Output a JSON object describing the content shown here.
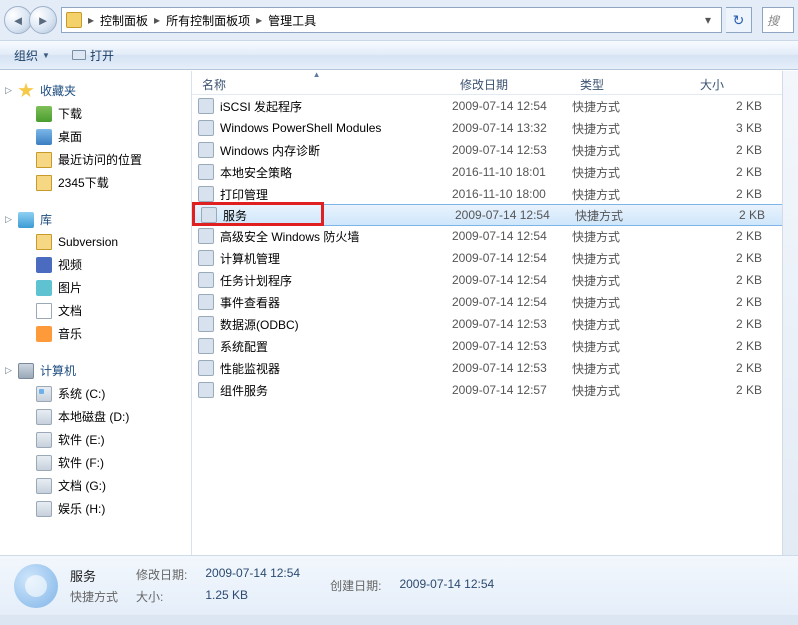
{
  "breadcrumbs": {
    "items": [
      "控制面板",
      "所有控制面板项",
      "管理工具"
    ]
  },
  "toolbar": {
    "organize": "组织",
    "open": "打开"
  },
  "search": {
    "placeholder": "搜"
  },
  "sidebar": {
    "favorites": {
      "label": "收藏夹",
      "items": [
        {
          "label": "下载",
          "icon": "dl"
        },
        {
          "label": "桌面",
          "icon": "desk"
        },
        {
          "label": "最近访问的位置",
          "icon": "fld"
        },
        {
          "label": "2345下载",
          "icon": "fld"
        }
      ]
    },
    "libraries": {
      "label": "库",
      "items": [
        {
          "label": "Subversion",
          "icon": "fld"
        },
        {
          "label": "视频",
          "icon": "vid"
        },
        {
          "label": "图片",
          "icon": "pic"
        },
        {
          "label": "文档",
          "icon": "doc"
        },
        {
          "label": "音乐",
          "icon": "mus"
        }
      ]
    },
    "computer": {
      "label": "计算机",
      "items": [
        {
          "label": "系统 (C:)",
          "icon": "cdrv"
        },
        {
          "label": "本地磁盘 (D:)",
          "icon": "drv"
        },
        {
          "label": "软件 (E:)",
          "icon": "drv"
        },
        {
          "label": "软件 (F:)",
          "icon": "drv"
        },
        {
          "label": "文档 (G:)",
          "icon": "drv"
        },
        {
          "label": "娱乐 (H:)",
          "icon": "drv"
        }
      ]
    }
  },
  "columns": {
    "name": "名称",
    "date": "修改日期",
    "type": "类型",
    "size": "大小"
  },
  "files": [
    {
      "name": "iSCSI 发起程序",
      "date": "2009-07-14 12:54",
      "type": "快捷方式",
      "size": "2 KB"
    },
    {
      "name": "Windows PowerShell Modules",
      "date": "2009-07-14 13:32",
      "type": "快捷方式",
      "size": "3 KB"
    },
    {
      "name": "Windows 内存诊断",
      "date": "2009-07-14 12:53",
      "type": "快捷方式",
      "size": "2 KB"
    },
    {
      "name": "本地安全策略",
      "date": "2016-11-10 18:01",
      "type": "快捷方式",
      "size": "2 KB"
    },
    {
      "name": "打印管理",
      "date": "2016-11-10 18:00",
      "type": "快捷方式",
      "size": "2 KB"
    },
    {
      "name": "服务",
      "date": "2009-07-14 12:54",
      "type": "快捷方式",
      "size": "2 KB",
      "selected": true,
      "highlight": true
    },
    {
      "name": "高级安全 Windows 防火墙",
      "date": "2009-07-14 12:54",
      "type": "快捷方式",
      "size": "2 KB"
    },
    {
      "name": "计算机管理",
      "date": "2009-07-14 12:54",
      "type": "快捷方式",
      "size": "2 KB"
    },
    {
      "name": "任务计划程序",
      "date": "2009-07-14 12:54",
      "type": "快捷方式",
      "size": "2 KB"
    },
    {
      "name": "事件查看器",
      "date": "2009-07-14 12:54",
      "type": "快捷方式",
      "size": "2 KB"
    },
    {
      "name": "数据源(ODBC)",
      "date": "2009-07-14 12:53",
      "type": "快捷方式",
      "size": "2 KB"
    },
    {
      "name": "系统配置",
      "date": "2009-07-14 12:53",
      "type": "快捷方式",
      "size": "2 KB"
    },
    {
      "name": "性能监视器",
      "date": "2009-07-14 12:53",
      "type": "快捷方式",
      "size": "2 KB"
    },
    {
      "name": "组件服务",
      "date": "2009-07-14 12:57",
      "type": "快捷方式",
      "size": "2 KB"
    }
  ],
  "details": {
    "title": "服务",
    "subtitle": "快捷方式",
    "modified_label": "修改日期:",
    "modified": "2009-07-14 12:54",
    "created_label": "创建日期:",
    "created": "2009-07-14 12:54",
    "size_label": "大小:",
    "size": "1.25 KB"
  }
}
